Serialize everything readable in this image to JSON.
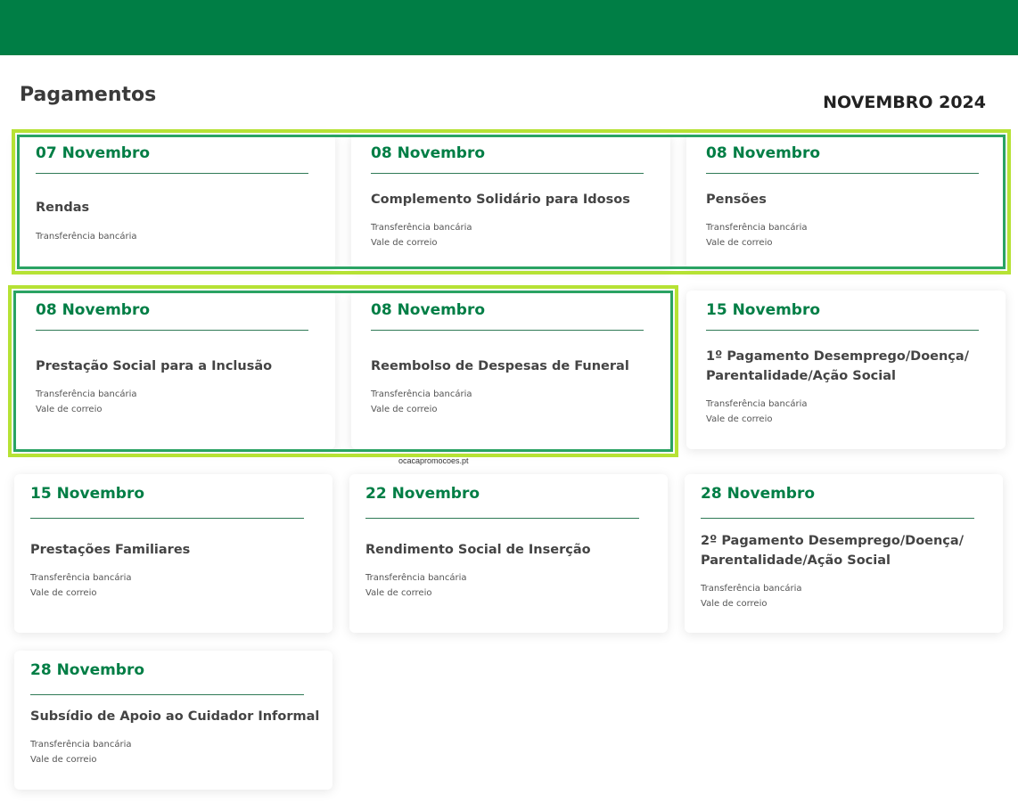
{
  "header": {
    "title": "Pagamentos",
    "month": "NOVEMBRO 2024"
  },
  "watermark": "ocacapromocoes.pt",
  "colors": {
    "brand_green": "#007e45",
    "highlight_outer": "#b6e234",
    "highlight_inner": "#2aa363"
  },
  "cards": [
    {
      "date": "07 Novembro",
      "name": "Rendas",
      "methods": [
        "Transferência bancária"
      ]
    },
    {
      "date": "08 Novembro",
      "name": "Complemento Solidário para Idosos",
      "methods": [
        "Transferência bancária",
        "Vale de correio"
      ]
    },
    {
      "date": "08 Novembro",
      "name": "Pensões",
      "methods": [
        "Transferência bancária",
        "Vale de correio"
      ]
    },
    {
      "date": "08 Novembro",
      "name": "Prestação Social para a Inclusão",
      "methods": [
        "Transferência bancária",
        "Vale de correio"
      ]
    },
    {
      "date": "08 Novembro",
      "name": "Reembolso de Despesas de Funeral",
      "methods": [
        "Transferência bancária",
        "Vale de correio"
      ]
    },
    {
      "date": "15 Novembro",
      "name_lines": [
        "1º Pagamento Desemprego/Doença/",
        "Parentalidade/Ação Social"
      ],
      "methods": [
        "Transferência bancária",
        "Vale de correio"
      ]
    },
    {
      "date": "15 Novembro",
      "name": "Prestações Familiares",
      "methods": [
        "Transferência bancária",
        "Vale de correio"
      ]
    },
    {
      "date": "22 Novembro",
      "name": "Rendimento Social de Inserção",
      "methods": [
        "Transferência bancária",
        "Vale de correio"
      ]
    },
    {
      "date": "28 Novembro",
      "name_lines": [
        "2º Pagamento Desemprego/Doença/",
        "Parentalidade/Ação Social"
      ],
      "methods": [
        "Transferência bancária",
        "Vale de correio"
      ]
    },
    {
      "date": "28 Novembro",
      "name": "Subsídio de Apoio ao Cuidador Informal",
      "methods": [
        "Transferência bancária",
        "Vale de correio"
      ]
    }
  ]
}
